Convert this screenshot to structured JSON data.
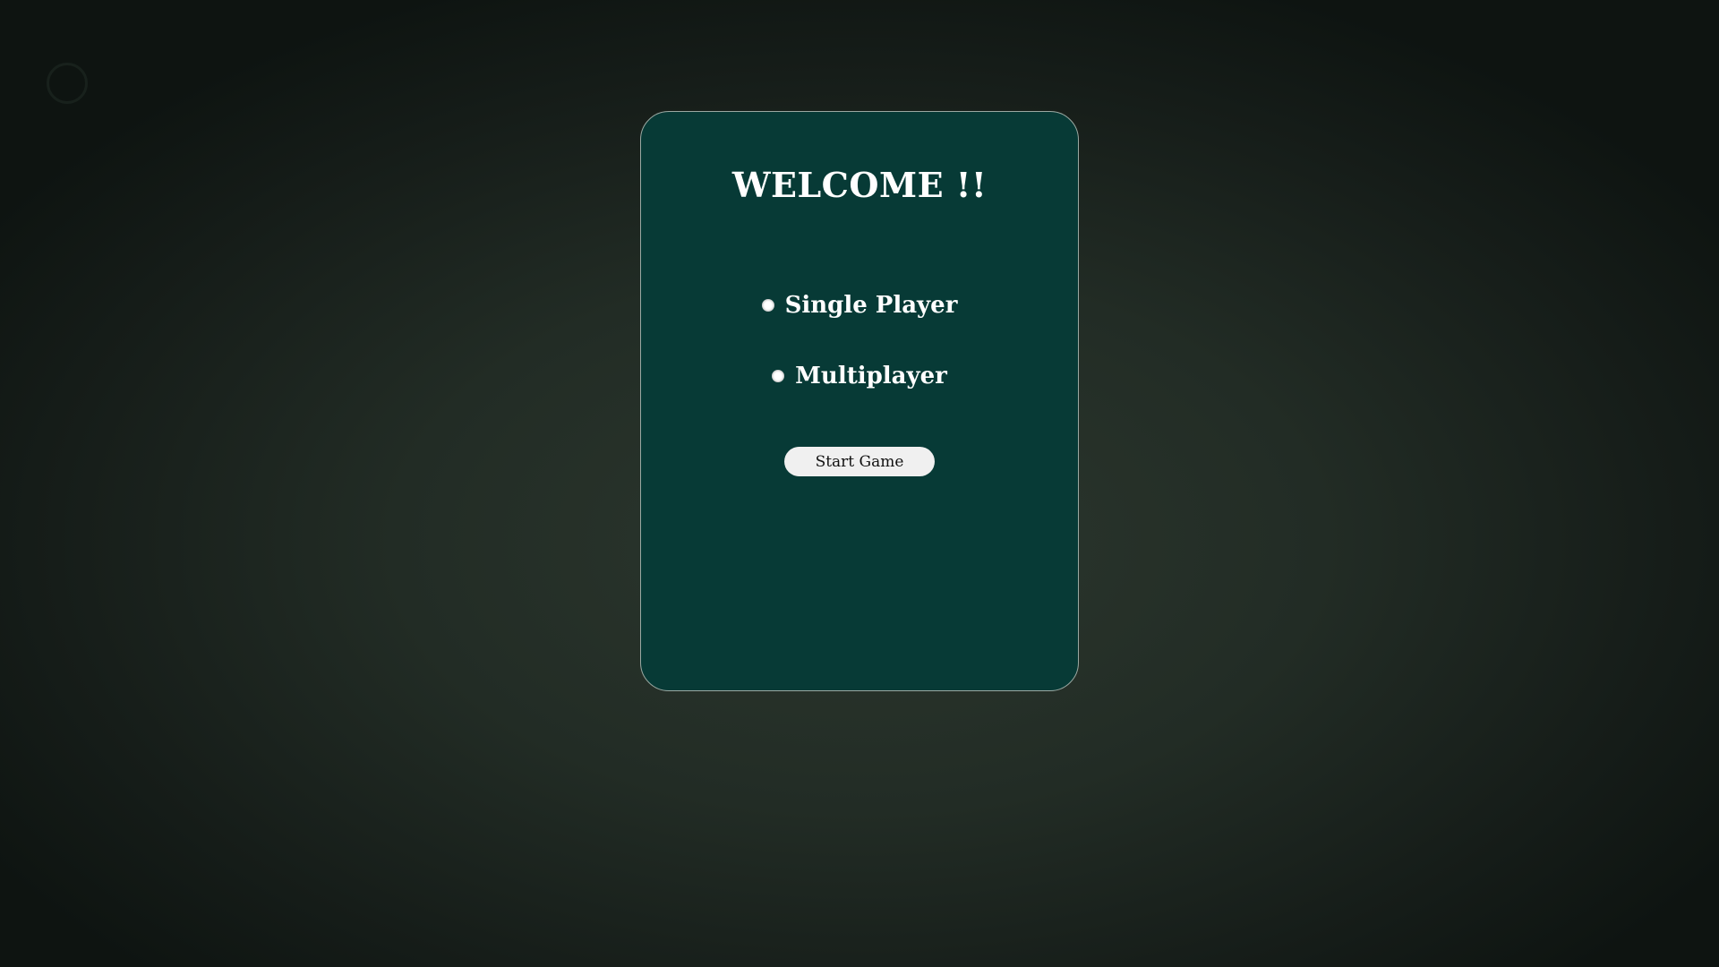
{
  "icons": {
    "corner": "circle-outline-icon"
  },
  "colors": {
    "card_background": "#073a36",
    "card_border": "#9aa8a2",
    "page_background": "#222c25",
    "text": "#ffffff",
    "button_background": "#f0f0f0"
  },
  "menu": {
    "title": "WELCOME !!",
    "options": [
      {
        "label": "Single Player",
        "selected": false
      },
      {
        "label": "Multiplayer",
        "selected": false
      }
    ],
    "start_button_label": "Start Game"
  }
}
